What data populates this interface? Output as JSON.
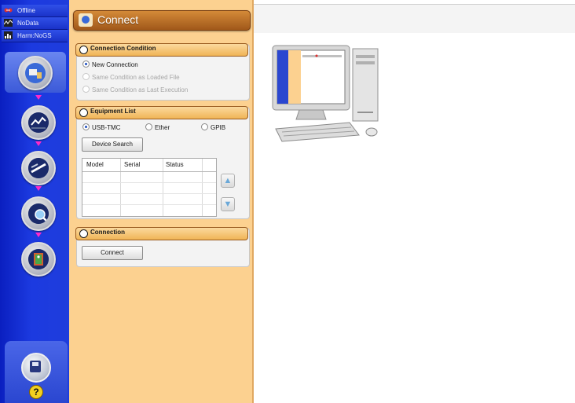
{
  "status": {
    "offline": "Offline",
    "nodata": "NoData",
    "harm": "Harm:NoGS"
  },
  "panel": {
    "title": "Connect"
  },
  "connection_condition": {
    "title": "Connection Condition",
    "options": [
      {
        "label": "New Connection",
        "selected": true,
        "enabled": true
      },
      {
        "label": "Same Condition as Loaded File",
        "selected": false,
        "enabled": false
      },
      {
        "label": "Same Condition as Last Execution",
        "selected": false,
        "enabled": false
      }
    ]
  },
  "equipment_list": {
    "title": "Equipment List",
    "interfaces": [
      {
        "label": "USB-TMC",
        "selected": true
      },
      {
        "label": "Ether",
        "selected": false
      },
      {
        "label": "GPIB",
        "selected": false
      }
    ],
    "search_button": "Device Search",
    "columns": [
      "Model",
      "Serial",
      "Status"
    ]
  },
  "connection": {
    "title": "Connection",
    "connect_button": "Connect"
  },
  "colors": {
    "rail": "#1f3ddc",
    "panel": "#fcd190",
    "title_bar": "#b86a28",
    "arrow": "#ff28c8"
  },
  "icons": {
    "help": "?"
  }
}
